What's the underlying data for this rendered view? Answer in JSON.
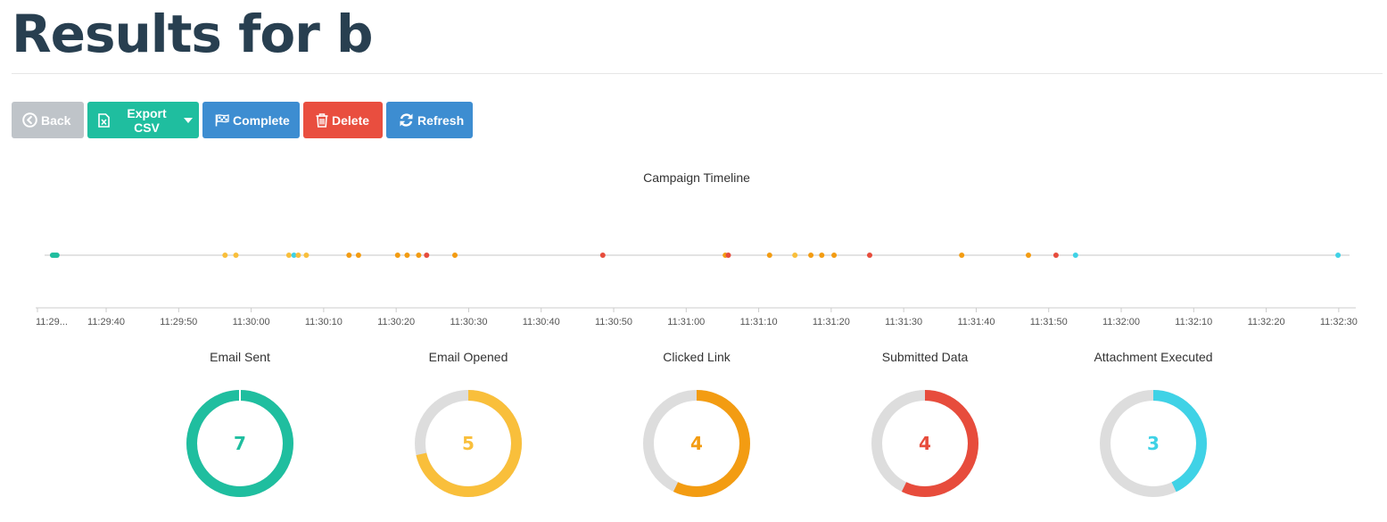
{
  "header": {
    "title": "Results for b"
  },
  "toolbar": {
    "back_label": "Back",
    "export_label": "Export CSV",
    "complete_label": "Complete",
    "delete_label": "Delete",
    "refresh_label": "Refresh"
  },
  "colors": {
    "sent": "#1fbe9f",
    "opened": "#f9bf3b",
    "clicked": "#f39c12",
    "submitted": "#e74c3c",
    "executed": "#3fd2e6",
    "track": "#dddddd"
  },
  "chart_data": [
    {
      "type": "scatter",
      "title": "Campaign Timeline",
      "x_unit": "time (HH:MM:SS)",
      "xlim": [
        "11:29:32",
        "11:32:31"
      ],
      "ticks": [
        "11:29...",
        "11:29:40",
        "11:29:50",
        "11:30:00",
        "11:30:10",
        "11:30:20",
        "11:30:30",
        "11:30:40",
        "11:30:50",
        "11:31:00",
        "11:31:10",
        "11:31:20",
        "11:31:30",
        "11:31:40",
        "11:31:50",
        "11:32:00",
        "11:32:10",
        "11:32:20",
        "11:32:30"
      ],
      "grid": false,
      "events": [
        {
          "time": "11:29:32.6",
          "kind": "sent"
        },
        {
          "time": "11:29:32.8",
          "kind": "sent"
        },
        {
          "time": "11:29:33.0",
          "kind": "sent"
        },
        {
          "time": "11:29:33.2",
          "kind": "sent"
        },
        {
          "time": "11:29:56.4",
          "kind": "opened"
        },
        {
          "time": "11:29:57.9",
          "kind": "opened"
        },
        {
          "time": "11:30:05.2",
          "kind": "opened"
        },
        {
          "time": "11:30:05.9",
          "kind": "executed"
        },
        {
          "time": "11:30:06.5",
          "kind": "opened"
        },
        {
          "time": "11:30:07.6",
          "kind": "opened"
        },
        {
          "time": "11:30:13.5",
          "kind": "clicked"
        },
        {
          "time": "11:30:14.8",
          "kind": "clicked"
        },
        {
          "time": "11:30:20.2",
          "kind": "clicked"
        },
        {
          "time": "11:30:21.5",
          "kind": "clicked"
        },
        {
          "time": "11:30:23.1",
          "kind": "clicked"
        },
        {
          "time": "11:30:24.2",
          "kind": "submitted"
        },
        {
          "time": "11:30:28.1",
          "kind": "clicked"
        },
        {
          "time": "11:30:48.5",
          "kind": "submitted"
        },
        {
          "time": "11:31:05.4",
          "kind": "clicked"
        },
        {
          "time": "11:31:05.8",
          "kind": "submitted"
        },
        {
          "time": "11:31:11.5",
          "kind": "clicked"
        },
        {
          "time": "11:31:15.0",
          "kind": "opened"
        },
        {
          "time": "11:31:17.2",
          "kind": "clicked"
        },
        {
          "time": "11:31:18.7",
          "kind": "clicked"
        },
        {
          "time": "11:31:20.4",
          "kind": "clicked"
        },
        {
          "time": "11:31:25.3",
          "kind": "submitted"
        },
        {
          "time": "11:31:38.0",
          "kind": "clicked"
        },
        {
          "time": "11:31:47.2",
          "kind": "clicked"
        },
        {
          "time": "11:31:51.0",
          "kind": "submitted"
        },
        {
          "time": "11:31:53.7",
          "kind": "executed"
        },
        {
          "time": "11:32:29.9",
          "kind": "executed"
        }
      ]
    },
    {
      "type": "pie",
      "title": "Email Sent",
      "value": 7,
      "total": 7,
      "fraction": 1.0,
      "color": "#1fbe9f"
    },
    {
      "type": "pie",
      "title": "Email Opened",
      "value": 5,
      "total": 7,
      "fraction": 0.714,
      "color": "#f9bf3b"
    },
    {
      "type": "pie",
      "title": "Clicked Link",
      "value": 4,
      "total": 7,
      "fraction": 0.571,
      "color": "#f39c12"
    },
    {
      "type": "pie",
      "title": "Submitted Data",
      "value": 4,
      "total": 7,
      "fraction": 0.571,
      "color": "#e74c3c"
    },
    {
      "type": "pie",
      "title": "Attachment Executed",
      "value": 3,
      "total": 7,
      "fraction": 0.429,
      "color": "#3fd2e6"
    }
  ]
}
